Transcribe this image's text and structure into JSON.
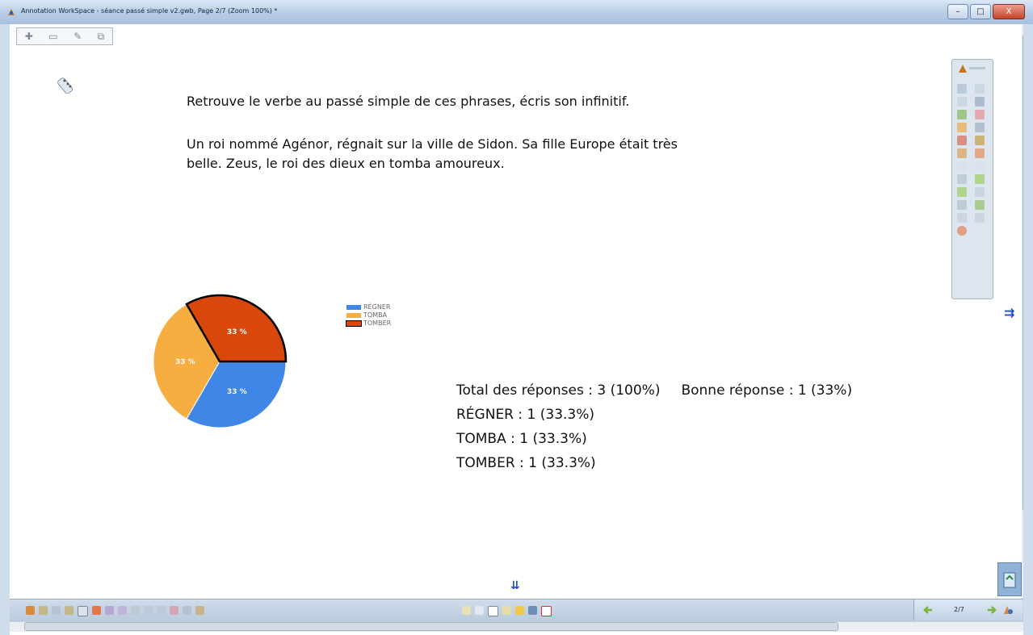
{
  "window": {
    "title": "Annotation WorkSpace - séance passé simple v2.gwb, Page 2/7  (Zoom 100%) *",
    "min_label": "–",
    "max_label": "□",
    "close_label": "X"
  },
  "content": {
    "question": "Retrouve le verbe au passé simple de ces phrases, écris son infinitif.",
    "sentence_line1": "Un roi nommé Agénor, régnait sur la ville de Sidon. Sa fille Europe était très",
    "sentence_line2": "belle. Zeus, le roi des dieux en tomba amoureux."
  },
  "stats": {
    "total": "Total des réponses : 3 (100%)",
    "correct": "Bonne réponse : 1 (33%)",
    "line_regner": "RÉGNER : 1 (33.3%)",
    "line_tomba": "TOMBA : 1 (33.3%)",
    "line_tomber": "TOMBER : 1 (33.3%)"
  },
  "chart_data": {
    "type": "pie",
    "values": [
      33.3,
      33.3,
      33.3
    ],
    "labels": [
      "33 %",
      "33 %",
      "33 %"
    ],
    "legend": [
      "RÉGNER",
      "TOMBA",
      "TOMBER"
    ],
    "colors": [
      "#3f86e6",
      "#f5ae3f",
      "#d9470d"
    ],
    "highlighted": "TOMBER",
    "legend_placement": "right"
  },
  "pagination": {
    "current": "2/7"
  },
  "icons": {
    "prev_page": "arrow-left-icon",
    "next_page": "arrow-right-icon",
    "scroll_down": "double-down-arrow-icon",
    "side_toggle": "side-panel-toggle-icon"
  }
}
